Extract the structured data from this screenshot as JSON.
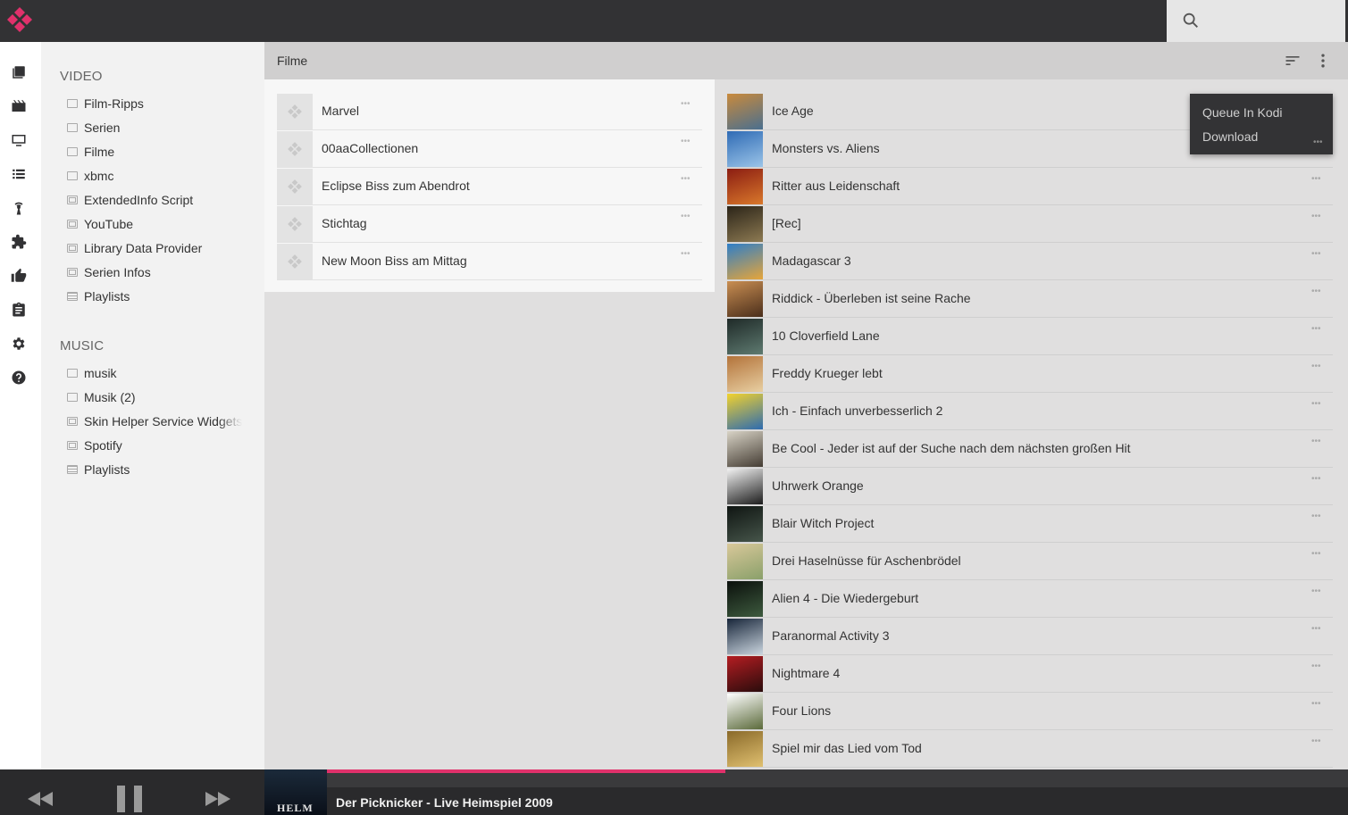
{
  "app": {
    "accent_color": "#e0316b",
    "topbar_color": "#323234"
  },
  "search": {
    "placeholder": ""
  },
  "rail": {
    "icons": [
      "library-icon",
      "movies-icon",
      "tv-icon",
      "list-icon",
      "radio-icon",
      "addons-icon",
      "thumbs-up-icon",
      "clipboard-icon",
      "settings-icon",
      "help-icon"
    ]
  },
  "sidebar": {
    "video_heading": "VIDEO",
    "video_items": [
      {
        "label": "Film-Ripps",
        "icon": "folder-icon"
      },
      {
        "label": "Serien",
        "icon": "folder-icon"
      },
      {
        "label": "Filme",
        "icon": "folder-icon"
      },
      {
        "label": "xbmc",
        "icon": "folder-icon"
      },
      {
        "label": "ExtendedInfo Script",
        "icon": "addon-icon"
      },
      {
        "label": "YouTube",
        "icon": "addon-icon"
      },
      {
        "label": "Library Data Provider",
        "icon": "addon-icon"
      },
      {
        "label": "Serien Infos",
        "icon": "addon-icon"
      },
      {
        "label": "Playlists",
        "icon": "playlist-icon"
      }
    ],
    "music_heading": "MUSIC",
    "music_items": [
      {
        "label": "musik",
        "icon": "folder-icon"
      },
      {
        "label": "Musik (2)",
        "icon": "folder-icon"
      },
      {
        "label": "Skin Helper Service Widgets",
        "icon": "addon-icon"
      },
      {
        "label": "Spotify",
        "icon": "addon-icon"
      },
      {
        "label": "Playlists",
        "icon": "playlist-icon"
      }
    ]
  },
  "header": {
    "title": "Filme"
  },
  "collections": [
    {
      "label": "Marvel"
    },
    {
      "label": "00aaCollectionen"
    },
    {
      "label": "Eclipse Biss zum Abendrot"
    },
    {
      "label": "Stichtag"
    },
    {
      "label": "New Moon Biss am Mittag"
    }
  ],
  "movies": [
    {
      "label": "Ice Age",
      "c1": "#c98a3c",
      "c2": "#4a6f8f"
    },
    {
      "label": "Monsters vs. Aliens",
      "c1": "#2f6bb5",
      "c2": "#9bc4e8"
    },
    {
      "label": "Ritter aus Leidenschaft",
      "c1": "#8b1d12",
      "c2": "#d9782b"
    },
    {
      "label": "[Rec]",
      "c1": "#2b2418",
      "c2": "#8d7a52"
    },
    {
      "label": "Madagascar 3",
      "c1": "#2e7ec8",
      "c2": "#e6a53a"
    },
    {
      "label": "Riddick - Überleben ist seine Rache",
      "c1": "#c98e52",
      "c2": "#4a2e1b"
    },
    {
      "label": "10 Cloverfield Lane",
      "c1": "#1f2a28",
      "c2": "#5e7a70"
    },
    {
      "label": "Freddy Krueger lebt",
      "c1": "#b3733a",
      "c2": "#e8cfa2"
    },
    {
      "label": "Ich - Einfach unverbesserlich 2",
      "c1": "#f2d22e",
      "c2": "#2d6bb0"
    },
    {
      "label": "Be Cool - Jeder ist auf der Suche nach dem nächsten großen Hit",
      "c1": "#d8d3c6",
      "c2": "#443c33"
    },
    {
      "label": "Uhrwerk Orange",
      "c1": "#f2f2f2",
      "c2": "#1c1c1c"
    },
    {
      "label": "Blair Witch Project",
      "c1": "#0f1512",
      "c2": "#46554a"
    },
    {
      "label": "Drei Haselnüsse für Aschenbrödel",
      "c1": "#d9c89a",
      "c2": "#8aa06a"
    },
    {
      "label": "Alien 4 - Die Wiedergeburt",
      "c1": "#0b100c",
      "c2": "#3d5a3e"
    },
    {
      "label": "Paranormal Activity 3",
      "c1": "#18263a",
      "c2": "#c9d4de"
    },
    {
      "label": "Nightmare 4",
      "c1": "#b51d22",
      "c2": "#2a0c0c"
    },
    {
      "label": "Four Lions",
      "c1": "#ffffff",
      "c2": "#5b6a3a"
    },
    {
      "label": "Spiel mir das Lied vom Tod",
      "c1": "#8a6a2a",
      "c2": "#e0c070"
    }
  ],
  "context_menu": {
    "items": [
      "Queue In Kodi",
      "Download"
    ]
  },
  "player": {
    "now_playing": "Der Picknicker - Live Heimspiel 2009",
    "art_text": "HELM",
    "progress": 0.39
  }
}
